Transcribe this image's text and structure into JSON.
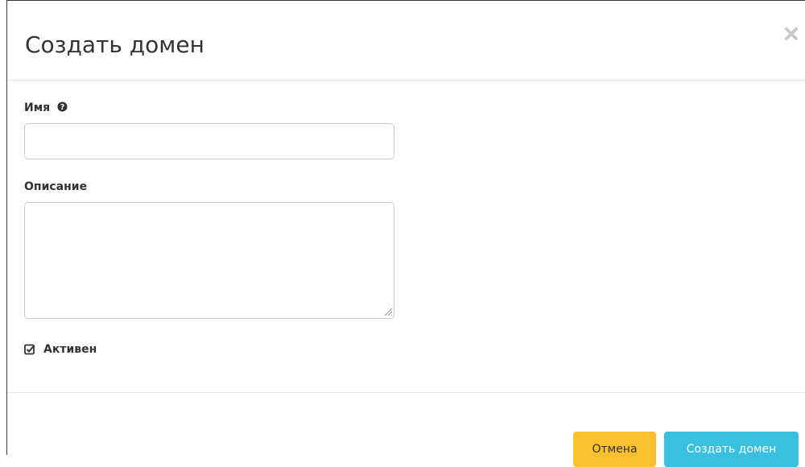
{
  "dialog": {
    "title": "Создать домен"
  },
  "form": {
    "name_label": "Имя",
    "name_value": "",
    "description_label": "Описание",
    "description_value": "",
    "active_label": "Активен",
    "active_checked": true
  },
  "footer": {
    "cancel_label": "Отмена",
    "submit_label": "Создать домен"
  },
  "colors": {
    "cancel_button": "#fbc02d",
    "submit_button": "#39c0e0"
  },
  "icons": {
    "close": "close-icon",
    "help": "question-circle-icon",
    "checkbox": "checked-square-icon",
    "resize": "resize-grip-icon"
  }
}
